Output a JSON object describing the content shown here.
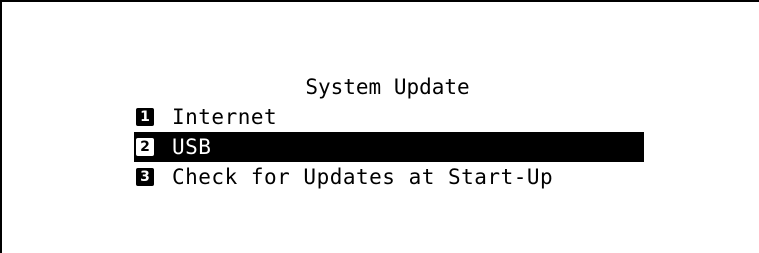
{
  "screen": {
    "title": "System Update",
    "items": [
      {
        "number": "1",
        "label": "Internet",
        "selected": false
      },
      {
        "number": "2",
        "label": "USB",
        "selected": true
      },
      {
        "number": "3",
        "label": "Check for Updates at Start-Up",
        "selected": false
      }
    ]
  },
  "colors": {
    "background": "#ffffff",
    "foreground": "#000000",
    "highlight": "#000000",
    "highlight_text": "#ffffff"
  }
}
